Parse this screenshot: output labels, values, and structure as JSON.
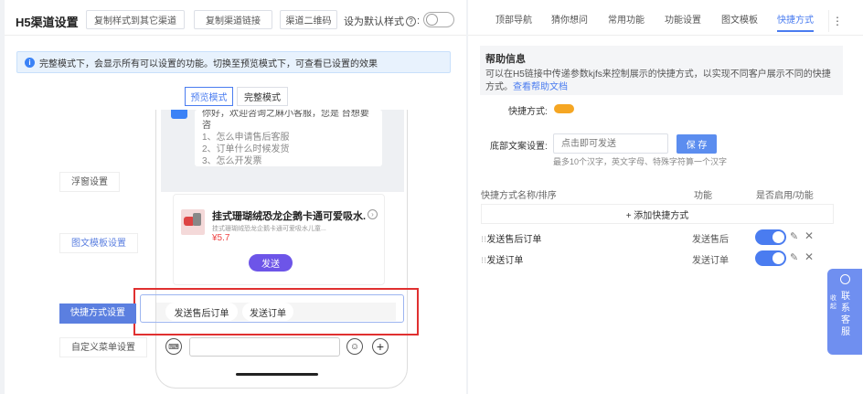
{
  "header": {
    "title": "H5渠道设置",
    "copy_style_btn": "复制样式到其它渠道",
    "copy_link_btn": "复制渠道链接",
    "qrcode_btn": "渠道二维码",
    "default_style_label": "设为默认样式",
    "help_glyph": "?"
  },
  "notice": "完整模式下，会显示所有可以设置的功能。切换至预览模式下，可查看已设置的效果",
  "mode_tabs": [
    "预览模式",
    "完整模式"
  ],
  "preview": {
    "greeting": "你好，欢迎咨询之麻小客服，您是 台想要咨",
    "menu_items": [
      "1、怎么申请售后客服",
      "2、订单什么时候发货",
      "3、怎么开发票"
    ],
    "product_title": "挂式珊瑚绒恐龙企鹅卡通可爱吸水...",
    "product_sub": "挂式珊瑚绒恐龙企鹅卡通可爱吸水儿童...",
    "product_price": "¥5.7",
    "send_btn": "发送",
    "quick_chips": [
      "发送售后订单",
      "发送订单"
    ]
  },
  "side_labels": {
    "float": "浮窗设置",
    "graphic": "图文模板设置",
    "quick": "快捷方式设置",
    "menu": "自定义菜单设置"
  },
  "right_tabs": [
    "顶部导航",
    "猜你想问",
    "常用功能",
    "功能设置",
    "图文模板",
    "快捷方式"
  ],
  "right_tabs_more": "⋮",
  "help": {
    "title": "帮助信息",
    "text": "可以在H5链接中传递参数kjfs来控制展示的快捷方式，以实现不同客户展示不同的快捷方式。",
    "link": "查看帮助文档"
  },
  "quick_label": "快捷方式:",
  "footer_setting": {
    "label": "底部文案设置:",
    "placeholder": "点击即可发送",
    "save": "保 存",
    "hint": "最多10个汉字，英文字母、特殊字符算一个汉字"
  },
  "table": {
    "headers": [
      "快捷方式名称/排序",
      "功能",
      "是否启用/功能"
    ],
    "add_label": "+ 添加快捷方式",
    "rows": [
      {
        "name": "发送售后订单",
        "func": "发送售后",
        "enabled": true
      },
      {
        "name": "发送订单",
        "func": "发送订单",
        "enabled": true
      }
    ]
  },
  "float_widget": {
    "collapse": "收起",
    "contact": "联系客服"
  },
  "colors": {
    "primary": "#4a7cf0",
    "selection_box": "#e03030",
    "side_highlight": "#5b7fe0"
  }
}
